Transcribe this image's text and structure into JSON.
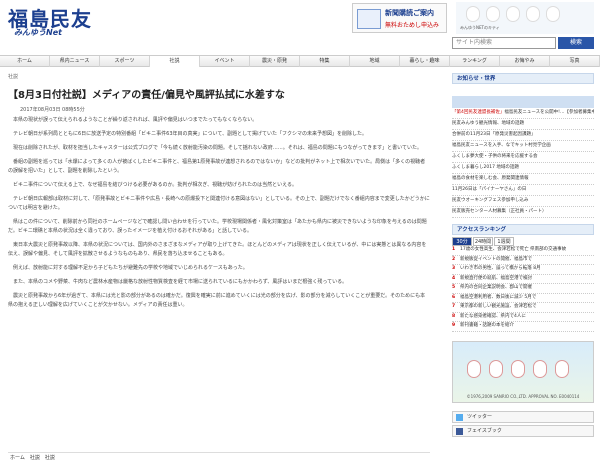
{
  "site": {
    "logo": "福島民友",
    "logo_sub": "みんゆうNet"
  },
  "ad": {
    "title": "新聞購読ご案内",
    "subtitle": "無料おためし申込み"
  },
  "kitty": {
    "caption": "みんゆうNETのキティ"
  },
  "search": {
    "placeholder": "サイト内検索",
    "button": "検索"
  },
  "nav": [
    "ホーム",
    "県内ニュース",
    "スポーツ",
    "社説",
    "イベント",
    "震災・原発",
    "特集",
    "地域",
    "暮らし・趣味",
    "ランキング",
    "お悔やみ",
    "写真"
  ],
  "breadcrumb": "社説",
  "article": {
    "title": "【8月3日付社説】メディアの責任/偏見や風評払拭に水差すな",
    "date": "2017年08月03日 08時55分",
    "paragraphs": [
      "本県の現状が誤って伝えられるようなことが繰り返されれば、風評や偏見はいつまでたってもなくならない。",
      "テレビ朝日が系列局とともに6日に放送予定の特別番組「ビキニ事件63年目の真実」について、副題として掲げていた「フクシマの未来予想図」を削除した。",
      "現在は削除されたが、取材を担当したキャスターは公式ブログで「今も続く放射能汚染の問題。そして揺れない政府……。それは、福島の問題にもつながってきます」と書いていた。",
      "番組の副題を巡っては「水爆によって多くの人が被ばくしたビキニ事件と、福島第1原発事故が連想されるのではないか」などの批判がネット上で相次いでいた。局側は「多くの視聴者の誤解を招いた」として、副題を削除したという。",
      "ビキニ事件について伝える上で、なぜ福島を結びつける必要があるのか。批判が相次ぎ、視聴が妨げられたのは当然といえる。",
      "テレビ朝日広報部は取材に対して、「原発事故とビキニ事件や広島・長崎への原爆投下と関連付ける意図はない」としている。その上で、副題だけでなく番組内容まで変更したかどうかについては明言を避けた。",
      "県はこの件について、削除前から同社のホームページなどで確認し問い合わせを行っていた。学校現場関係者・風化対策室は「あたかも県内に被災できないような印象を与えるのは問題だ。ビキニ環礁と本県の状況は全く違っており、誤ったイメージを植え付けるおそれがある」と話している。",
      "東日本大震災と原発事故以降、本県の状況については、国内外のさまざまなメディアが取り上げてきた。ほとんどのメディアは現状を正しく伝えているが、中には実態とは異なる内容を伝え、誤解や偏見、そして風評を拡散させるようなものもあり、県民を落ち込ませることもある。",
      "例えば、放射能に対する理解不足から子どもたちが避難先の学校や地域でいじめられるケースもあった。",
      "また、本県のコメや野菜、牛肉など農林水産物は厳格な放射性物質検査を経て市場に送られているにもかかわらず、風評はいまだ根強く残っている。",
      "震災と原発事故から6年が過ぎて、本県には光と影の部分があるのは確かだ。復興を確実に前に進めていくには光の部分を広げ、影の部分を減らしていくことが重要だ。そのためにも本県の抱える正しい理解を広げていくことが欠かせない。メディアの責任は重い。"
    ],
    "tags": "ホーム　社説　社説"
  },
  "sidebar": {
    "notice_title": "お知らせ・世界",
    "news": [
      {
        "hl": "「第4回民友連盟長補佐」",
        "text": "福島民友ニュースを公開中!…【参加者募集中】"
      },
      {
        "hl": "",
        "text": "民友みんゆう観光情報、地域の話題"
      },
      {
        "hl": "",
        "text": "合併前の11月23日「原発災害起因課題」"
      },
      {
        "hl": "",
        "text": "福島民友ニュースを入手、なでキット村見学企画"
      },
      {
        "hl": "",
        "text": "ふくしま夢大使・子供の将来を応援する会"
      },
      {
        "hl": "",
        "text": "ふくしま暮らし2017 地域の話題"
      },
      {
        "hl": "",
        "text": "福島の食材を楽しむ会、原発関連情報"
      },
      {
        "hl": "",
        "text": "11月26日は「パイナーヤさん」の日"
      },
      {
        "hl": "",
        "text": "民友ウオーキングフェス参加申し込み"
      },
      {
        "hl": "",
        "text": "民友販売センター人材募集（正社員・パート）"
      }
    ],
    "ranking_title": "アクセスランキング",
    "ranking_tabs": [
      "30分",
      "24時間",
      "1週間"
    ],
    "ranking": [
      "17歳の女性高生、会津若松で死亡 県南部の交通事故",
      "新規販促イベントの開催、福島市で",
      "いわき市の男性、誤って橋から転落 8月",
      "新規直行便の就航、福島空港で検討",
      "県内の合同企業説明会、郡山で開催",
      "福島空港利用者、数日後に減少 5月で",
      "東京都の新しい観光施設、会津若松で",
      "新たな感染者確認、県内で4人に",
      "新刊書籍・話題の本を紹介"
    ],
    "kitty_ad_caption": "©1976,2009 SANRIO CO.,LTD. APPROVAL NO. E0040114",
    "sns": [
      "ツイッター",
      "フェイスブック"
    ]
  }
}
